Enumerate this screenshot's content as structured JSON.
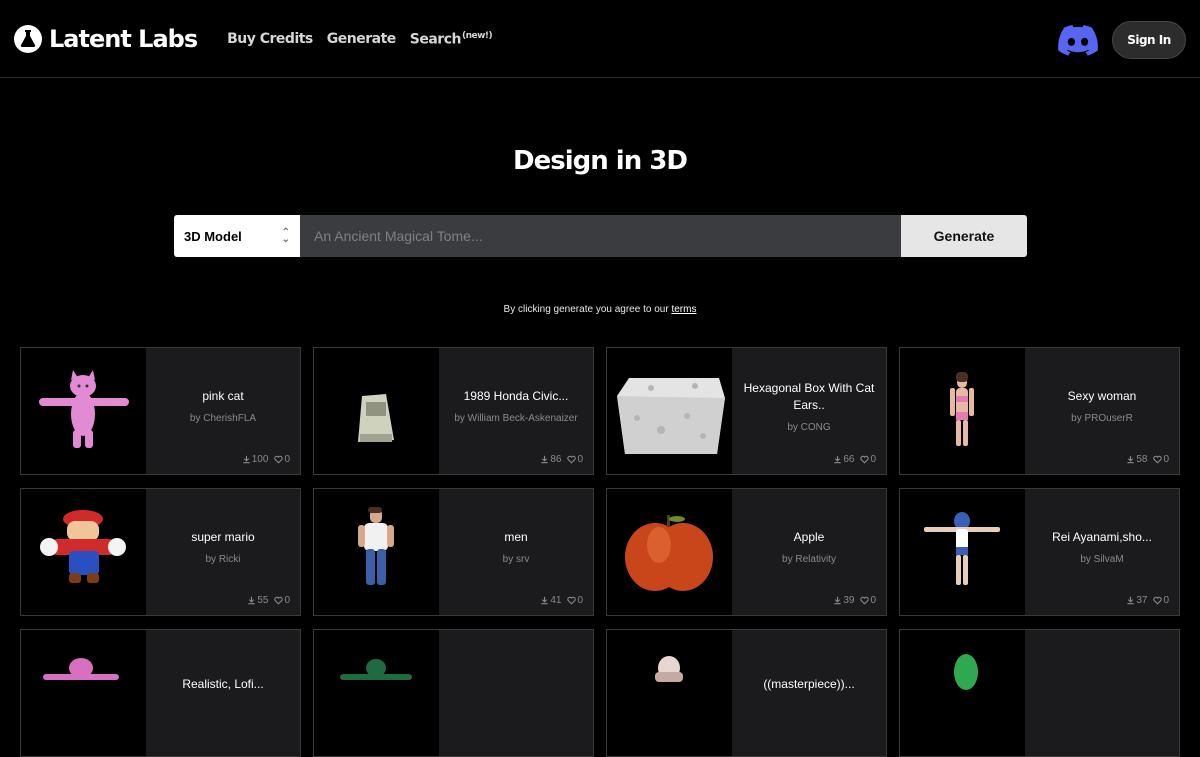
{
  "brand": {
    "name": "Latent Labs"
  },
  "nav": [
    {
      "label": "Buy Credits"
    },
    {
      "label": "Generate"
    },
    {
      "label": "Search",
      "badge": "(new!)"
    }
  ],
  "header": {
    "signin_label": "Sign In",
    "discord_icon": "discord-icon"
  },
  "hero": {
    "title": "Design in 3D"
  },
  "generator": {
    "mode_selected": "3D Model",
    "prompt_placeholder": "An Ancient Magical Tome...",
    "prompt_value": "",
    "button_label": "Generate"
  },
  "terms": {
    "text": "By clicking generate you agree to our ",
    "link_label": "terms"
  },
  "colors": {
    "discord": "#5865f2",
    "card_bg": "#1b1b1d",
    "input_bg": "#3b3c40"
  },
  "cards": [
    {
      "title": "pink cat",
      "author": "by CherishFLA",
      "downloads": "100",
      "likes": "0",
      "thumb": "pink-cat"
    },
    {
      "title": "1989 Honda Civic...",
      "author": "by William Beck-Askenaizer",
      "downloads": "86",
      "likes": "0",
      "thumb": "car"
    },
    {
      "title": "Hexagonal Box With Cat Ears..",
      "author": "by CONG",
      "downloads": "66",
      "likes": "0",
      "thumb": "box"
    },
    {
      "title": "Sexy woman",
      "author": "by PROuserR",
      "downloads": "58",
      "likes": "0",
      "thumb": "woman"
    },
    {
      "title": "super mario",
      "author": "by Ricki",
      "downloads": "55",
      "likes": "0",
      "thumb": "mario"
    },
    {
      "title": "men",
      "author": "by srv",
      "downloads": "41",
      "likes": "0",
      "thumb": "man"
    },
    {
      "title": "Apple",
      "author": "by Relativity",
      "downloads": "39",
      "likes": "0",
      "thumb": "apple"
    },
    {
      "title": "Rei Ayanami,sho...",
      "author": "by SilvaM",
      "downloads": "37",
      "likes": "0",
      "thumb": "rei"
    },
    {
      "title": "Realistic, Lofi...",
      "author": "",
      "downloads": "",
      "likes": "",
      "thumb": "pink-figure"
    },
    {
      "title": "",
      "author": "",
      "downloads": "",
      "likes": "",
      "thumb": "green-figure"
    },
    {
      "title": "((masterpiece))...",
      "author": "",
      "downloads": "",
      "likes": "",
      "thumb": "pale-figure"
    },
    {
      "title": "",
      "author": "",
      "downloads": "",
      "likes": "",
      "thumb": "green-blob"
    }
  ]
}
